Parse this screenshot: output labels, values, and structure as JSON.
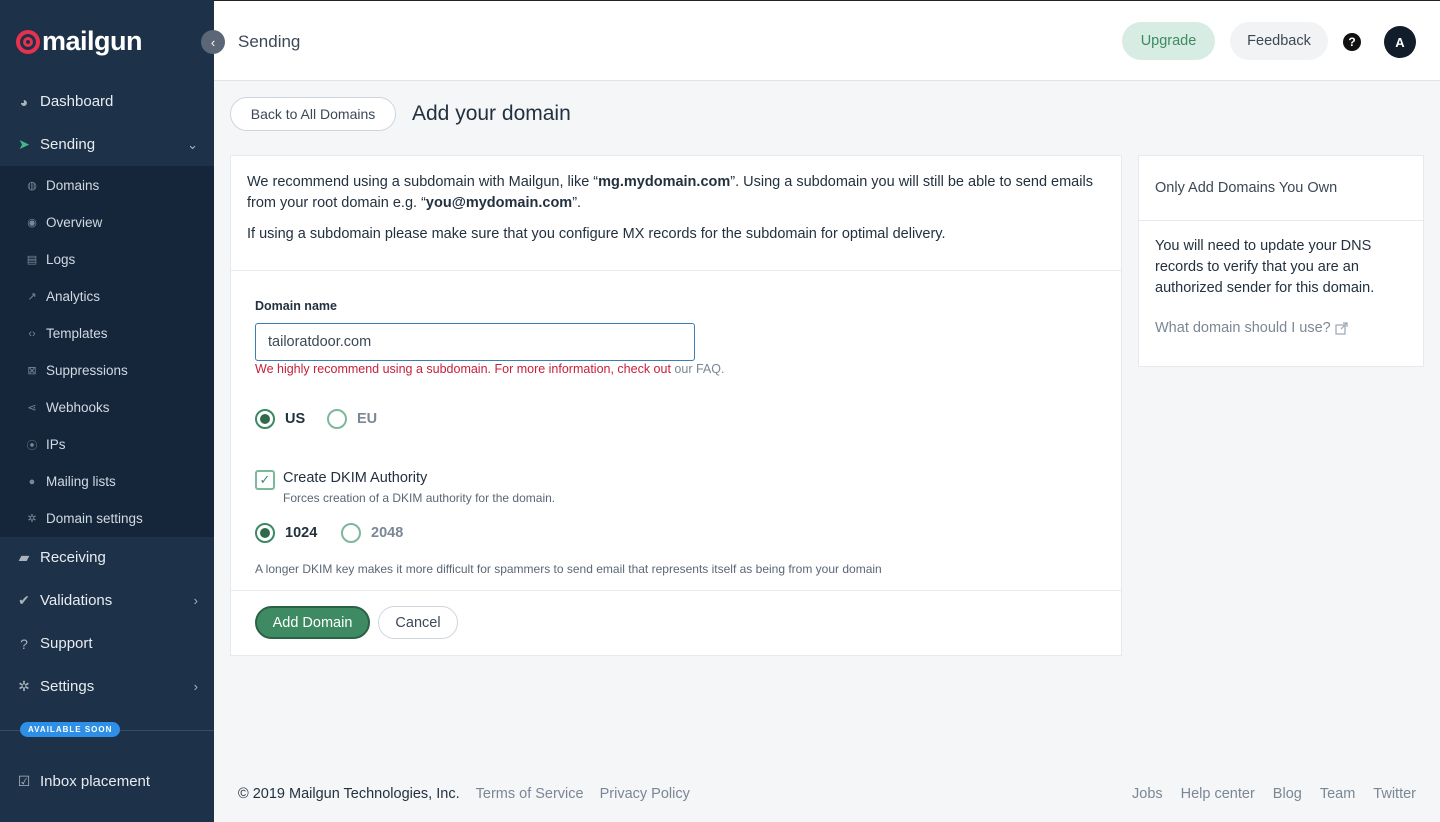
{
  "app": {
    "logo_text": "mailgun"
  },
  "sidebar": {
    "main": [
      {
        "label": "Dashboard",
        "icon": "dashboard-icon"
      },
      {
        "label": "Sending",
        "icon": "paper-plane-icon"
      },
      {
        "label": "Receiving",
        "icon": "inbox-icon"
      },
      {
        "label": "Validations",
        "icon": "check-person-icon"
      },
      {
        "label": "Support",
        "icon": "question-icon"
      },
      {
        "label": "Settings",
        "icon": "gear-icon"
      }
    ],
    "sub": [
      {
        "label": "Domains",
        "icon": "globe-icon"
      },
      {
        "label": "Overview",
        "icon": "eye-icon"
      },
      {
        "label": "Logs",
        "icon": "document-icon"
      },
      {
        "label": "Analytics",
        "icon": "trend-icon"
      },
      {
        "label": "Templates",
        "icon": "code-icon"
      },
      {
        "label": "Suppressions",
        "icon": "block-icon"
      },
      {
        "label": "Webhooks",
        "icon": "share-icon"
      },
      {
        "label": "IPs",
        "icon": "pin-icon"
      },
      {
        "label": "Mailing lists",
        "icon": "person-icon"
      },
      {
        "label": "Domain settings",
        "icon": "gear-icon"
      }
    ],
    "badge": "AVAILABLE SOON",
    "inbox_placement": "Inbox placement"
  },
  "header": {
    "title": "Sending",
    "upgrade": "Upgrade",
    "feedback": "Feedback",
    "help": "?",
    "avatar": "A"
  },
  "page": {
    "back_button": "Back to All Domains",
    "title": "Add your domain",
    "intro_1a": "We recommend using a subdomain with Mailgun, like “",
    "intro_1b": "mg.mydomain.com",
    "intro_1c": "”. Using a subdomain you will still be able to send emails from your root domain e.g. “",
    "intro_1d": "you@mydomain.com",
    "intro_1e": "”.",
    "intro_2": "If using a subdomain please make sure that you configure MX records for the subdomain for optimal delivery.",
    "domain_label": "Domain name",
    "domain_value": "tailoratdoor.com",
    "hint": "We highly recommend using a subdomain. For more information, check out",
    "hint_link": "our FAQ.",
    "region_us": "US",
    "region_eu": "EU",
    "dkim_label": "Create DKIM Authority",
    "dkim_sub": "Forces creation of a DKIM authority for the domain.",
    "key_1024": "1024",
    "key_2048": "2048",
    "dkim_note": "A longer DKIM key makes it more difficult for spammers to send email that represents itself as being from your domain",
    "add_button": "Add Domain",
    "cancel_button": "Cancel"
  },
  "side_card": {
    "head": "Only Add Domains You Own",
    "body": "You will need to update your DNS records to verify that you are an authorized sender for this domain.",
    "link": "What domain should I use?"
  },
  "footer": {
    "copyright": "© 2019 Mailgun Technologies, Inc.",
    "terms": "Terms of Service",
    "privacy": "Privacy Policy",
    "right_links": [
      "Jobs",
      "Help center",
      "Blog",
      "Team",
      "Twitter"
    ]
  },
  "colors": {
    "sidebar": "#1d3148",
    "subnav": "#15263a",
    "accent_green": "#3e8a63",
    "brand_red": "#e8314e",
    "error_red": "#c8203a"
  }
}
